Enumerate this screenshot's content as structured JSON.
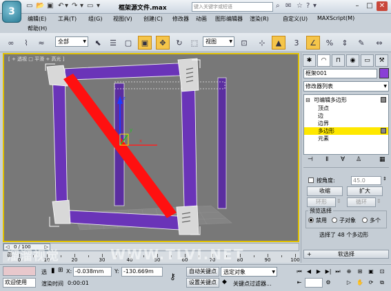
{
  "titlebar": {
    "app_logo": "3",
    "file_title": "框架源文件.max",
    "search_placeholder": "键入关键字或短语"
  },
  "menu": {
    "items": [
      "编辑(E)",
      "工具(T)",
      "组(G)",
      "视图(V)",
      "创建(C)",
      "修改器",
      "动画",
      "图形编辑器",
      "渲染(R)",
      "自定义(U)",
      "MAXScript(M)"
    ],
    "help": "帮助(H)"
  },
  "toolbar": {
    "selection_filter": "全部",
    "ref_coord": "视图"
  },
  "viewport": {
    "label": "[ + 透视 □ 平滑 + 高光 ]",
    "axis_x": "x",
    "axis_y": "y",
    "axis_z": "z"
  },
  "command_panel": {
    "object_name": "框架001",
    "object_color": "#8a3fd6",
    "modifier_list": "修改器列表",
    "stack": {
      "root": "可编辑多边形",
      "items": [
        "顶点",
        "边",
        "边界",
        "多边形",
        "元素"
      ],
      "selected": "多边形"
    },
    "by_angle_label": "按角度:",
    "by_angle_value": "45.0",
    "shrink": "收缩",
    "grow": "扩大",
    "ring": "环形",
    "loop": "循环",
    "preview_label": "预览选择",
    "preview_options": [
      "禁用",
      "子对象",
      "多个"
    ],
    "selection_info": "选择了 48 个多边形",
    "soft_selection": "软选择"
  },
  "timeline": {
    "frame_readout": "0 / 100",
    "ticks": [
      "0",
      "10",
      "20",
      "30",
      "40",
      "50",
      "60",
      "70",
      "80",
      "90",
      "100"
    ]
  },
  "statusbar": {
    "welcome": "欢迎使用",
    "select_label": "选",
    "x_label": "X:",
    "x_value": "-0.038mm",
    "y_label": "Y:",
    "y_value": "-130.669m",
    "render_time_label": "渲染时间",
    "render_time_value": "0:00:01",
    "auto_key": "自动关键点",
    "set_key": "设置关键点",
    "selected_object": "选定对象",
    "key_filters": "关键点过滤器..."
  },
  "watermark": {
    "left": "溜溜视觉",
    "right": "WWW.TLVI.NET"
  }
}
